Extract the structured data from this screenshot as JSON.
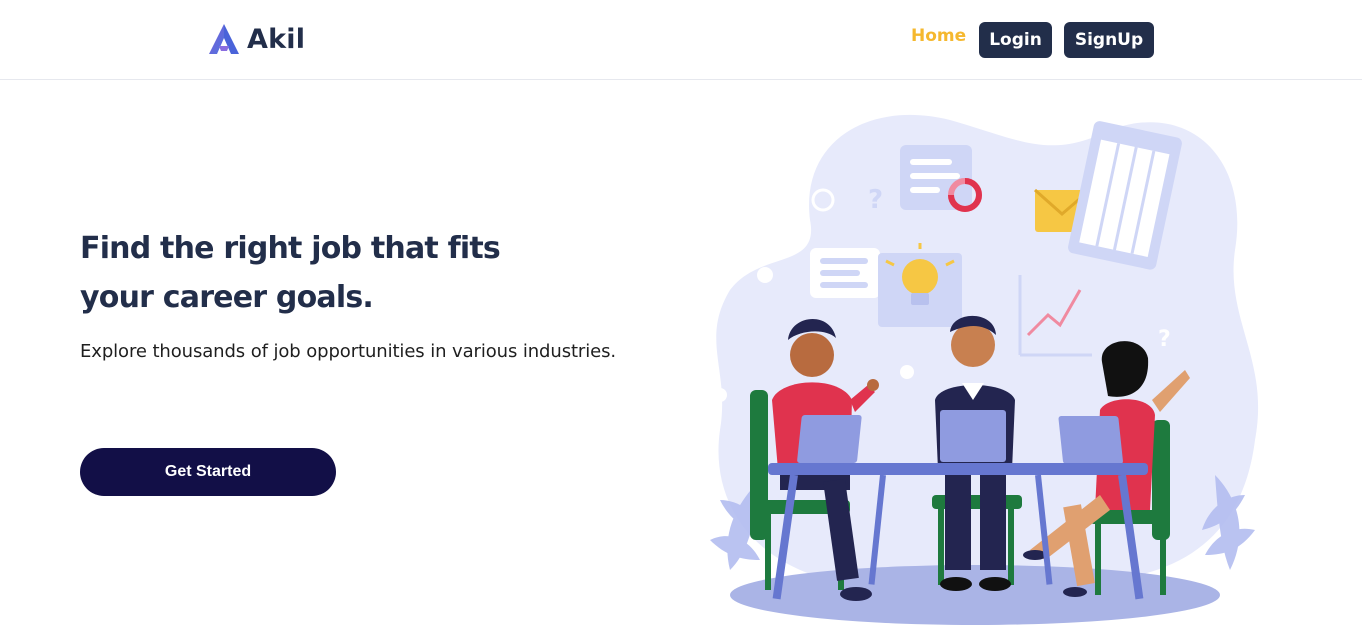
{
  "nav": {
    "brand": "Akil",
    "home": "Home",
    "login": "Login",
    "signup": "SignUp",
    "colors": {
      "brand_dark": "#222e4a",
      "active_link": "#f5b82e"
    }
  },
  "hero": {
    "title_line1": "Find the right job that fits",
    "title_line2": "your career goals.",
    "subtitle": "Explore thousands of job opportunities in various industries.",
    "cta_label": "Get Started",
    "colors": {
      "cta_bg": "#120f47"
    }
  },
  "illustration": {
    "icon": "team-meeting-illustration"
  }
}
